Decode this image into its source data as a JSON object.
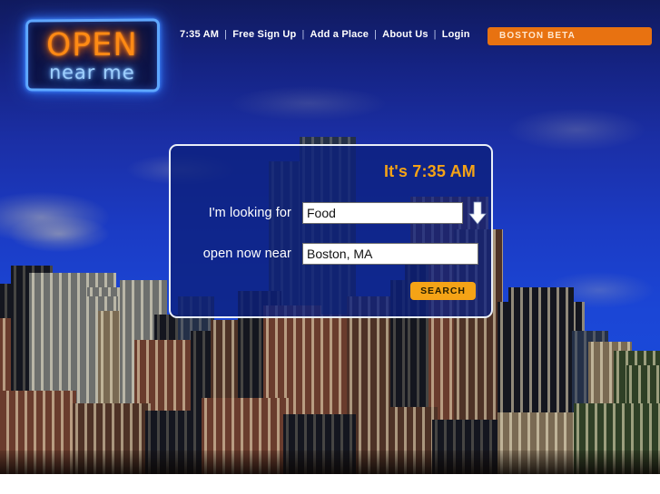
{
  "site": {
    "logo_line1": "OPEN",
    "logo_line2": "near me"
  },
  "header": {
    "time": "7:35 AM",
    "separator": "|",
    "links": [
      {
        "label": "Free Sign Up"
      },
      {
        "label": "Add a Place"
      },
      {
        "label": "About Us"
      },
      {
        "label": "Login"
      }
    ],
    "beta_badge": "BOSTON BETA",
    "beta_color": "#e87211"
  },
  "search_panel": {
    "time_heading": "It's 7:35 AM",
    "time_heading_color": "#f5a316",
    "label_what": "I'm looking for",
    "label_where": "open now near",
    "category_value": "Food",
    "category_placeholder": "Food",
    "location_value": "Boston, MA",
    "location_placeholder": "Boston, MA",
    "search_button": "SEARCH",
    "panel_background": "#0d217d",
    "panel_border": "#e9eef8"
  }
}
